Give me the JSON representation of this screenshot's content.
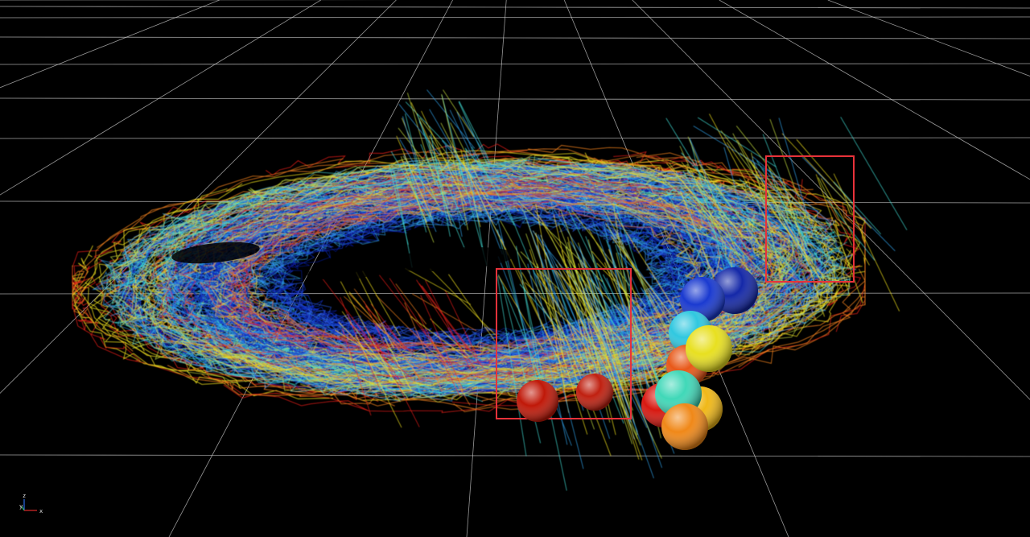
{
  "scene": {
    "background": "#000000",
    "grid_color": "#d8d8d8",
    "highlight_color": "#e8323a",
    "track_colors": [
      "#0a1a9a",
      "#1030c8",
      "#2a5ae0",
      "#30a0e8",
      "#40d8d0",
      "#c8e040",
      "#f0e020",
      "#f08020",
      "#e02018"
    ]
  },
  "spheres": [
    {
      "name": "sphere-dark-blue-2",
      "color": "#1428a8"
    },
    {
      "name": "sphere-blue",
      "color": "#1a3ad0"
    },
    {
      "name": "sphere-cyan",
      "color": "#30c8e0"
    },
    {
      "name": "sphere-yellow",
      "color": "#e8e020"
    },
    {
      "name": "sphere-orange-red",
      "color": "#e85818"
    },
    {
      "name": "sphere-teal",
      "color": "#40d8b8"
    },
    {
      "name": "sphere-red",
      "color": "#d81810"
    },
    {
      "name": "sphere-gold",
      "color": "#f0b818"
    },
    {
      "name": "sphere-orange",
      "color": "#f08818"
    },
    {
      "name": "sphere-red-left",
      "color": "#c01808"
    },
    {
      "name": "sphere-red-mid",
      "color": "#c02010"
    }
  ],
  "axis_triad": {
    "z_label": "z",
    "y_label": "y",
    "x_label": "x",
    "z_color": "#2a6ae8",
    "y_color": "#30c060",
    "x_color": "#e02a2a"
  }
}
